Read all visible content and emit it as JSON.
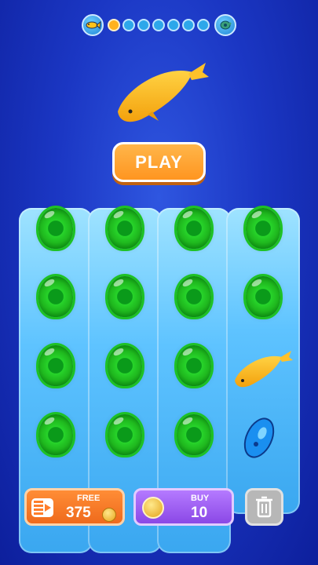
{
  "progress": {
    "total_dots": 7,
    "active_dots": 1,
    "start_icon": "yellow-fish-icon",
    "end_icon": "turtle-icon"
  },
  "play_button": {
    "label": "PLAY"
  },
  "board": {
    "rows": 4,
    "cols": 4,
    "items": [
      [
        "green-egg",
        "green-egg",
        "green-egg",
        "green-egg"
      ],
      [
        "green-egg",
        "green-egg",
        "green-egg",
        "green-egg"
      ],
      [
        "green-egg",
        "green-egg",
        "green-egg",
        "yellow-fish"
      ],
      [
        "green-egg",
        "green-egg",
        "green-egg",
        "blue-cocoon"
      ]
    ]
  },
  "free_button": {
    "label": "FREE",
    "amount": "375",
    "icon": "video-ad-icon"
  },
  "buy_button": {
    "label": "BUY",
    "amount": "10",
    "icon": "gold-coin-icon"
  },
  "trash_button": {
    "icon": "trash-icon"
  },
  "colors": {
    "primary": "#ff9520",
    "buy": "#8b48e6",
    "egg": "#1fb81e",
    "background": "#1b37c4"
  }
}
